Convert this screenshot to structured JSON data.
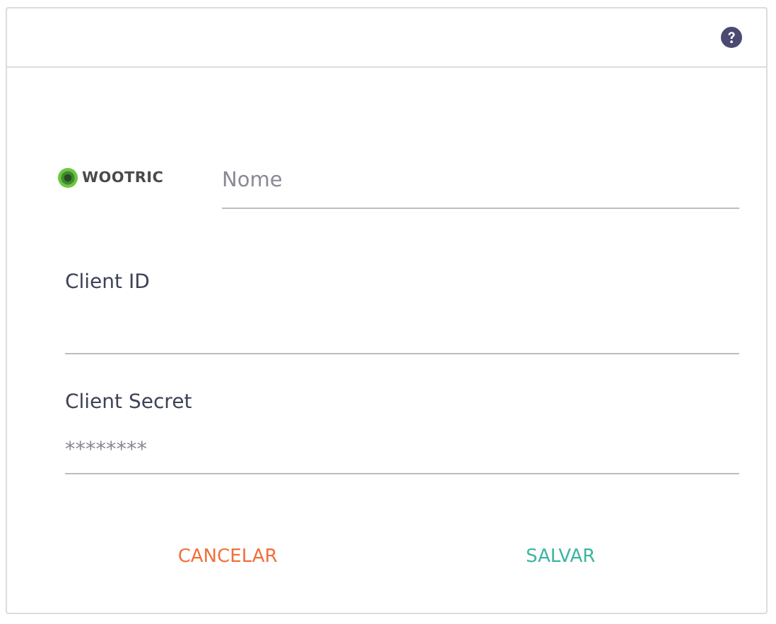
{
  "logo": {
    "text": "WOOTRIC"
  },
  "name_field": {
    "placeholder": "Nome"
  },
  "fields": [
    {
      "label": "Client ID"
    },
    {
      "label": "Client Secret",
      "placeholder": "********"
    }
  ],
  "buttons": [
    {
      "label": "CANCELAR",
      "kind": "cancel"
    },
    {
      "label": "SALVAR",
      "kind": "save"
    }
  ]
}
